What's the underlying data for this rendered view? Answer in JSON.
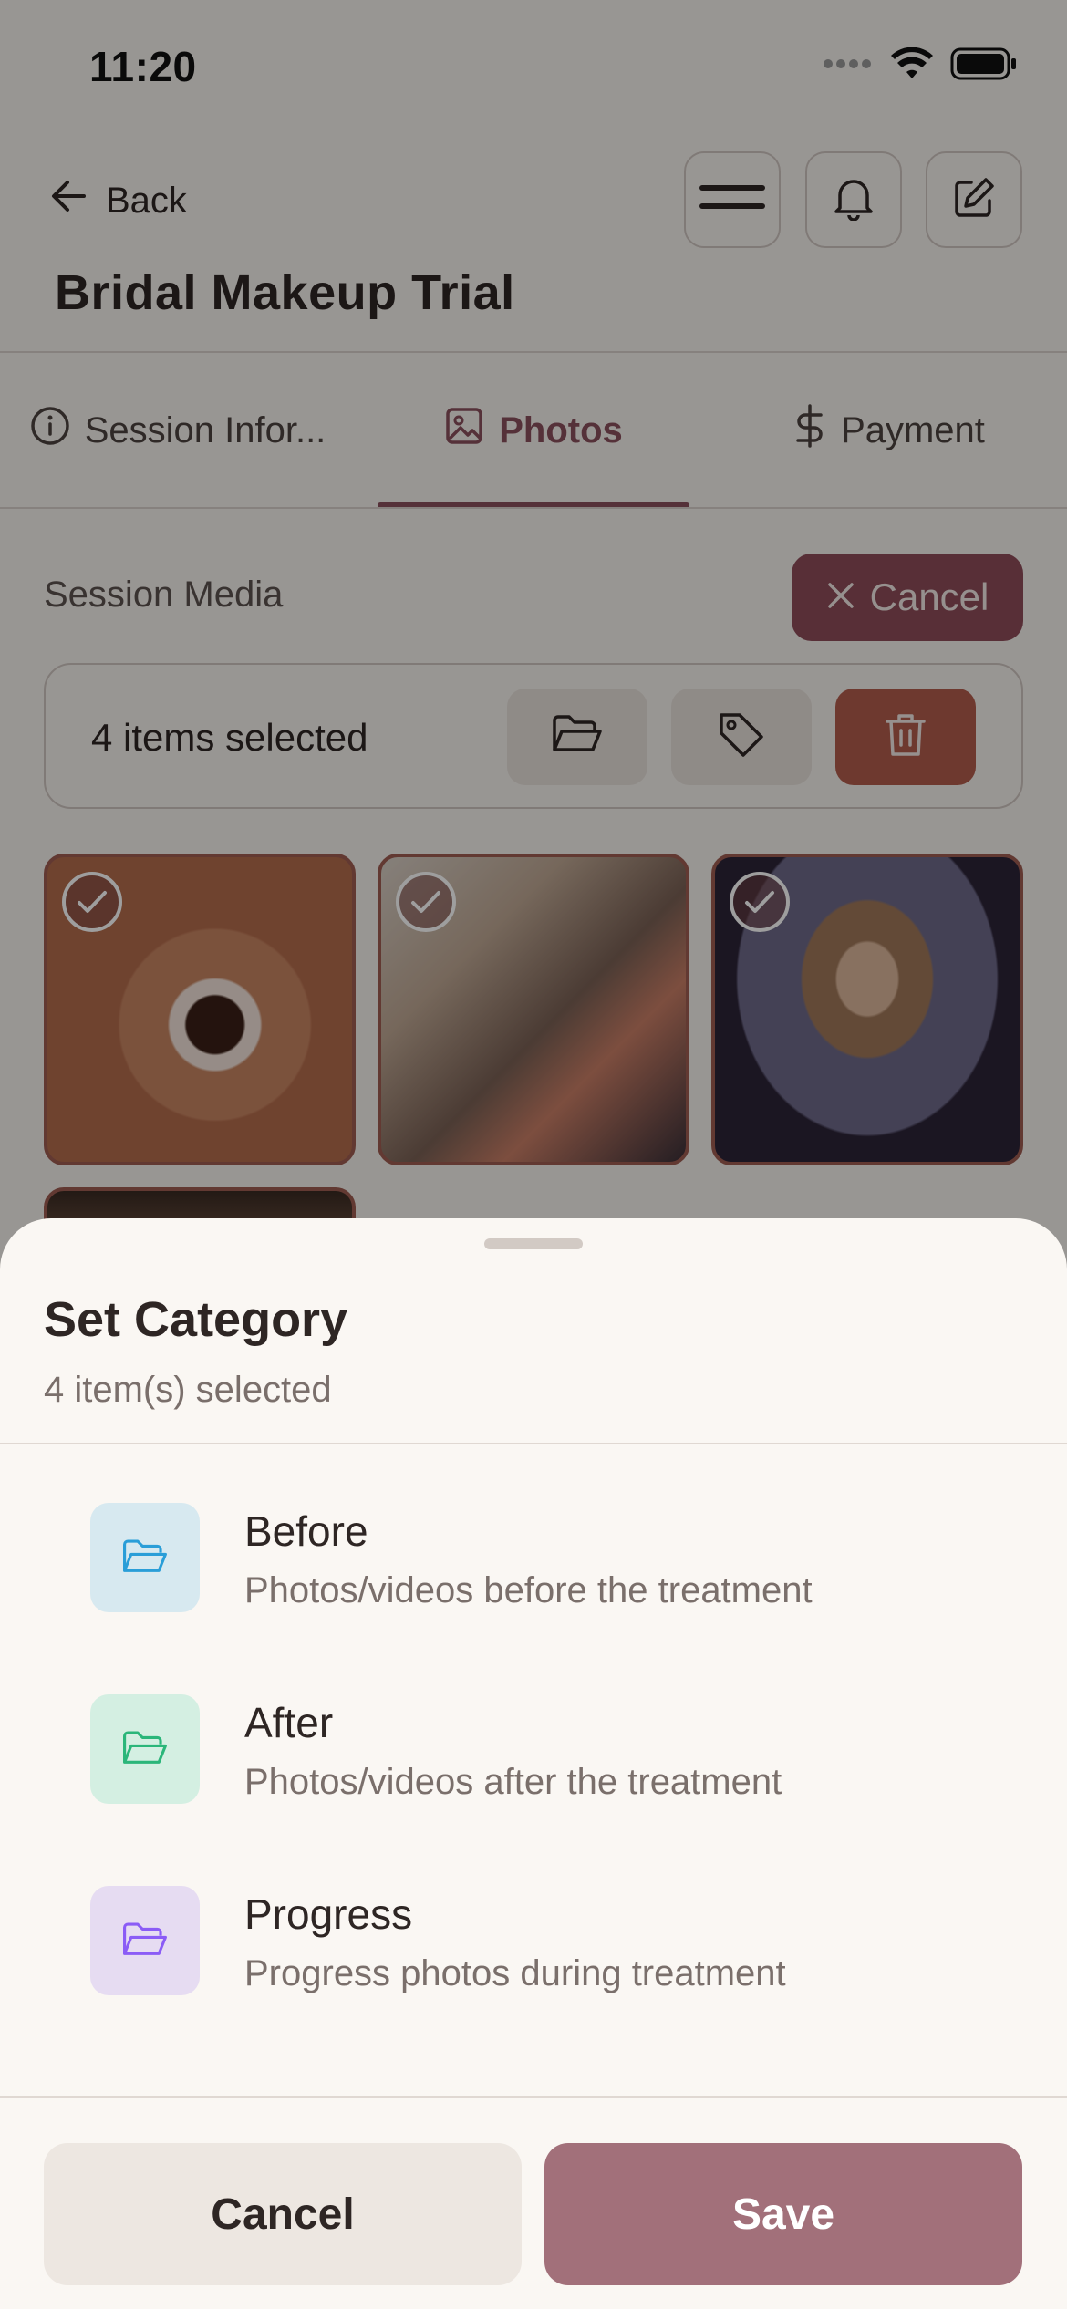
{
  "status_bar": {
    "time": "11:20"
  },
  "header": {
    "back_label": "Back",
    "title": "Bridal Makeup Trial"
  },
  "tabs": [
    {
      "label": "Session Infor...",
      "icon": "info-icon"
    },
    {
      "label": "Photos",
      "icon": "image-icon",
      "active": true
    },
    {
      "label": "Payment",
      "icon": "dollar-icon"
    }
  ],
  "media": {
    "section_label": "Session Media",
    "cancel_label": "Cancel",
    "selection_text": "4 items selected"
  },
  "sheet": {
    "title": "Set Category",
    "subtitle": "4 item(s) selected",
    "options": [
      {
        "title": "Before",
        "description": "Photos/videos before the treatment",
        "icon": "folder-open-icon",
        "color": "#2a9ed8",
        "bg": "#d7e9f0"
      },
      {
        "title": "After",
        "description": "Photos/videos after the treatment",
        "icon": "folder-open-icon",
        "color": "#2bb67a",
        "bg": "#d4efe2"
      },
      {
        "title": "Progress",
        "description": "Progress photos during treatment",
        "icon": "folder-open-icon",
        "color": "#8b5cf6",
        "bg": "#e6dcf2"
      }
    ],
    "cancel_label": "Cancel",
    "save_label": "Save"
  },
  "colors": {
    "accent": "#8a4f5c",
    "delete": "#b25c4c",
    "save": "#a2707a"
  }
}
